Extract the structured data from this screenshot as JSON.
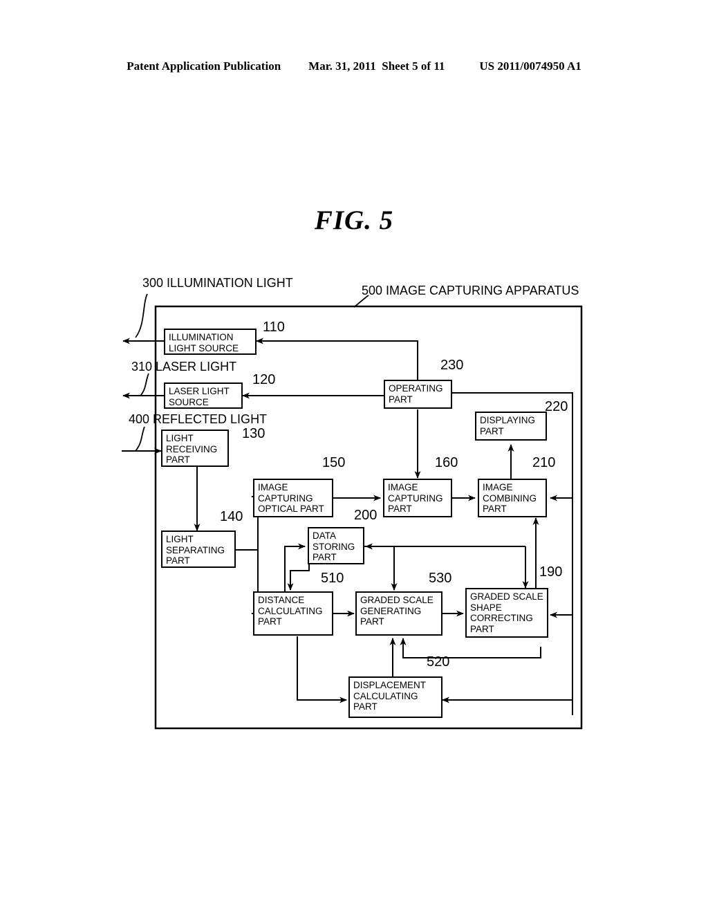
{
  "header": {
    "left": "Patent Application Publication",
    "middle": "Mar. 31, 2011  Sheet 5 of 11",
    "right": "US 2011/0074950 A1"
  },
  "figure": {
    "title": "FIG. 5"
  },
  "external_labels": [
    {
      "id": "label-300",
      "text": "300 ILLUMINATION LIGHT"
    },
    {
      "id": "label-310",
      "text": "310 LASER LIGHT"
    },
    {
      "id": "label-400",
      "text": "400 REFLECTED LIGHT"
    },
    {
      "id": "label-500",
      "text": "500 IMAGE CAPTURING APPARATUS"
    }
  ],
  "blocks": [
    {
      "ref": "110",
      "lines": [
        "ILLUMINATION",
        "LIGHT SOURCE"
      ]
    },
    {
      "ref": "120",
      "lines": [
        "LASER LIGHT",
        "SOURCE"
      ]
    },
    {
      "ref": "130",
      "lines": [
        "LIGHT",
        "RECEIVING",
        "PART"
      ]
    },
    {
      "ref": "140",
      "lines": [
        "LIGHT",
        "SEPARATING",
        "PART"
      ]
    },
    {
      "ref": "150",
      "lines": [
        "IMAGE",
        "CAPTURING",
        "OPTICAL PART"
      ]
    },
    {
      "ref": "160",
      "lines": [
        "IMAGE",
        "CAPTURING",
        "PART"
      ]
    },
    {
      "ref": "190",
      "lines": [
        "GRADED SCALE",
        "SHAPE",
        "CORRECTING",
        "PART"
      ]
    },
    {
      "ref": "200",
      "lines": [
        "DATA",
        "STORING",
        "PART"
      ]
    },
    {
      "ref": "210",
      "lines": [
        "IMAGE",
        "COMBINING",
        "PART"
      ]
    },
    {
      "ref": "220",
      "lines": [
        "DISPLAYING",
        "PART"
      ]
    },
    {
      "ref": "230",
      "lines": [
        "OPERATING",
        "PART"
      ]
    },
    {
      "ref": "510",
      "lines": [
        "DISTANCE",
        "CALCULATING",
        "PART"
      ]
    },
    {
      "ref": "520",
      "lines": [
        "DISPLACEMENT",
        "CALCULATING",
        "PART"
      ]
    },
    {
      "ref": "530",
      "lines": [
        "GRADED SCALE",
        "GENERATING",
        "PART"
      ]
    }
  ],
  "ref_numbers": {
    "n110": "110",
    "n120": "120",
    "n130": "130",
    "n140": "140",
    "n150": "150",
    "n160": "160",
    "n190": "190",
    "n200": "200",
    "n210": "210",
    "n220": "220",
    "n230": "230",
    "n510": "510",
    "n520": "520",
    "n530": "530"
  },
  "block_text": {
    "b110_l0": "ILLUMINATION",
    "b110_l1": "LIGHT SOURCE",
    "b120_l0": "LASER LIGHT",
    "b120_l1": "SOURCE",
    "b130_l0": "LIGHT",
    "b130_l1": "RECEIVING",
    "b130_l2": "PART",
    "b140_l0": "LIGHT",
    "b140_l1": "SEPARATING",
    "b140_l2": "PART",
    "b150_l0": "IMAGE",
    "b150_l1": "CAPTURING",
    "b150_l2": "OPTICAL PART",
    "b160_l0": "IMAGE",
    "b160_l1": "CAPTURING",
    "b160_l2": "PART",
    "b190_l0": "GRADED SCALE",
    "b190_l1": "SHAPE",
    "b190_l2": "CORRECTING",
    "b190_l3": "PART",
    "b200_l0": "DATA",
    "b200_l1": "STORING",
    "b200_l2": "PART",
    "b210_l0": "IMAGE",
    "b210_l1": "COMBINING",
    "b210_l2": "PART",
    "b220_l0": "DISPLAYING",
    "b220_l1": "PART",
    "b230_l0": "OPERATING",
    "b230_l1": "PART",
    "b510_l0": "DISTANCE",
    "b510_l1": "CALCULATING",
    "b510_l2": "PART",
    "b520_l0": "DISPLACEMENT",
    "b520_l1": "CALCULATING",
    "b520_l2": "PART",
    "b530_l0": "GRADED SCALE",
    "b530_l1": "GENERATING",
    "b530_l2": "PART"
  },
  "colors": {
    "ink": "#000000",
    "paper": "#ffffff"
  }
}
